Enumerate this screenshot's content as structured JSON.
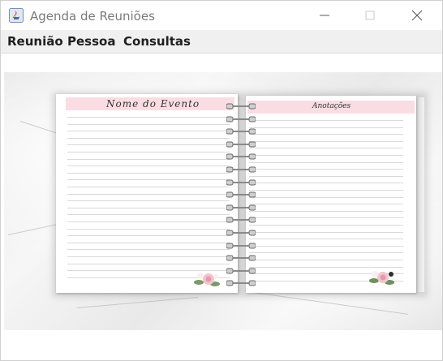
{
  "window": {
    "title": "Agenda de Reuniões",
    "controls": {
      "minimize": "—",
      "maximize": "☐",
      "close": "✕"
    }
  },
  "menubar": {
    "items": [
      "Reunião",
      "Pessoa",
      "Consultas"
    ]
  },
  "notebook": {
    "left_header": "Nome do Evento",
    "right_header": "Anotações"
  },
  "colors": {
    "header_band": "#f9dde3",
    "menu_bg": "#f0f0f0"
  },
  "icons": {
    "app": "java-app-icon",
    "flower": "rose-bouquet-icon"
  }
}
